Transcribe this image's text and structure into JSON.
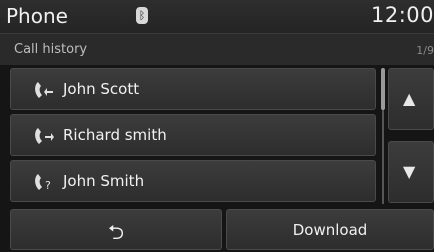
{
  "status": {
    "title": "Phone",
    "bluetooth_icon": "bluetooth-icon",
    "time": "12:00"
  },
  "header": {
    "section": "Call history",
    "page": "1/9"
  },
  "calls": [
    {
      "name": "John Scott",
      "type_icon": "incoming-call-icon"
    },
    {
      "name": "Richard smith",
      "type_icon": "outgoing-call-icon"
    },
    {
      "name": "John Smith",
      "type_icon": "missed-call-icon"
    }
  ],
  "controls": {
    "up_icon": "arrow-up-icon",
    "down_icon": "arrow-down-icon",
    "back_icon": "back-icon",
    "download_label": "Download"
  },
  "colors": {
    "background": "#151515",
    "button": "#333333",
    "text": "#f0f0f0"
  }
}
